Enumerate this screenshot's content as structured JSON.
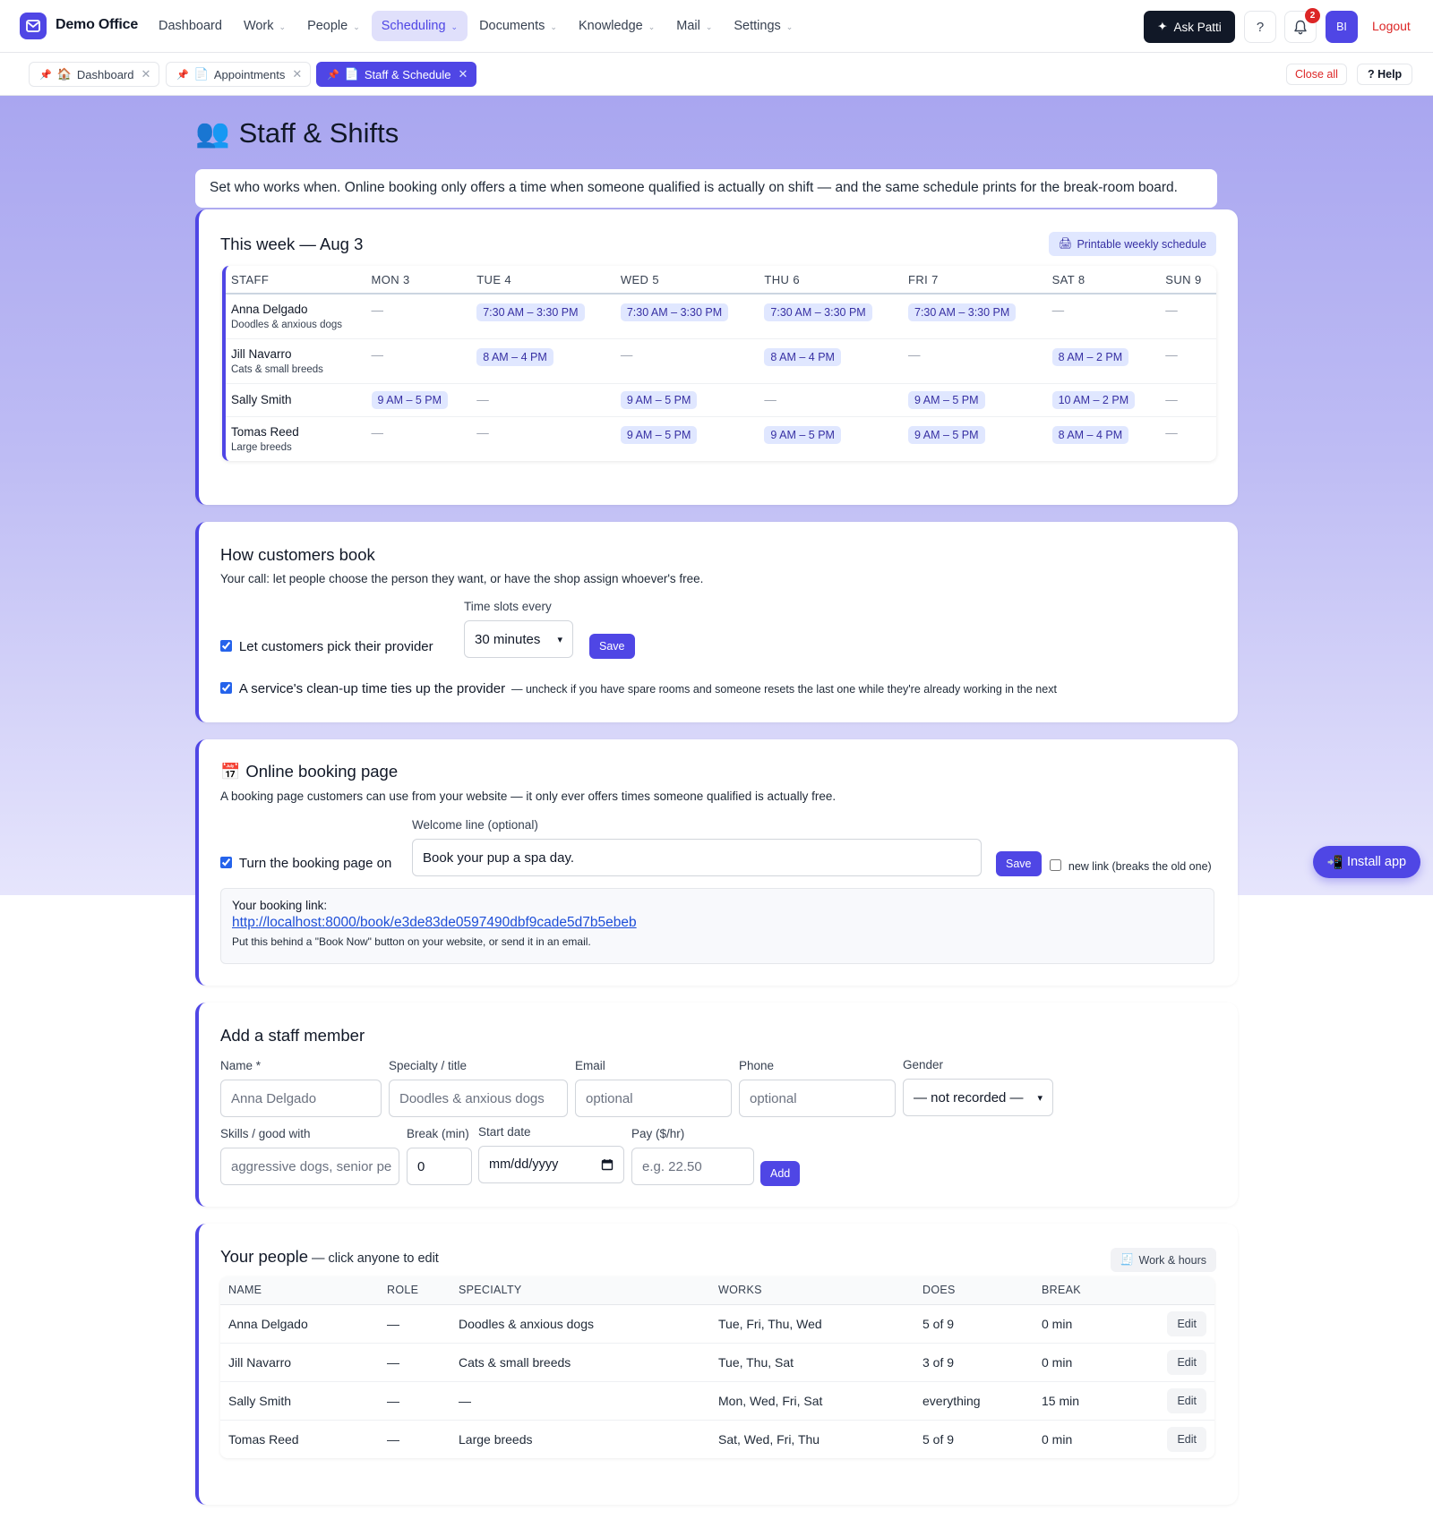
{
  "app": {
    "name": "Demo Office",
    "nav": [
      {
        "label": "Dashboard",
        "dropdown": false,
        "active": false
      },
      {
        "label": "Work",
        "dropdown": true,
        "active": false
      },
      {
        "label": "People",
        "dropdown": true,
        "active": false
      },
      {
        "label": "Scheduling",
        "dropdown": true,
        "active": true
      },
      {
        "label": "Documents",
        "dropdown": true,
        "active": false
      },
      {
        "label": "Knowledge",
        "dropdown": true,
        "active": false
      },
      {
        "label": "Mail",
        "dropdown": true,
        "active": false
      },
      {
        "label": "Settings",
        "dropdown": true,
        "active": false
      }
    ],
    "ask_label": "Ask Patti",
    "help_icon_label": "?",
    "notification_count": "2",
    "avatar_initials": "BI",
    "logout_label": "Logout",
    "accent_color": "#4f46e5"
  },
  "tabs": [
    {
      "pin": "📌",
      "icon": "🏠",
      "label": "Dashboard",
      "active": false
    },
    {
      "pin": "📌",
      "icon": "📄",
      "label": "Appointments",
      "active": false
    },
    {
      "pin": "📌",
      "icon": "📄",
      "label": "Staff & Schedule",
      "active": true
    }
  ],
  "tab_actions": {
    "close_all": "Close all",
    "help": "? Help"
  },
  "page": {
    "icon": "👥",
    "title": "Staff & Shifts",
    "intro": "Set who works when. Online booking only offers a time when someone qualified is actually on shift — and the same schedule prints for the break-room board."
  },
  "schedule": {
    "title": "This week — Aug 3",
    "print_icon": "🖨",
    "print_label": "Printable weekly schedule",
    "headers": [
      "STAFF",
      "MON 3",
      "TUE 4",
      "WED 5",
      "THU 6",
      "FRI 7",
      "SAT 8",
      "SUN 9"
    ],
    "rows": [
      {
        "name": "Anna Delgado",
        "specialty": "Doodles & anxious dogs",
        "shifts": [
          "—",
          "7:30 AM – 3:30 PM",
          "7:30 AM – 3:30 PM",
          "7:30 AM – 3:30 PM",
          "7:30 AM – 3:30 PM",
          "—",
          "—"
        ]
      },
      {
        "name": "Jill Navarro",
        "specialty": "Cats & small breeds",
        "shifts": [
          "—",
          "8 AM – 4 PM",
          "—",
          "8 AM – 4 PM",
          "—",
          "8 AM – 2 PM",
          "—"
        ]
      },
      {
        "name": "Sally Smith",
        "specialty": "",
        "shifts": [
          "9 AM – 5 PM",
          "—",
          "9 AM – 5 PM",
          "—",
          "9 AM – 5 PM",
          "10 AM – 2 PM",
          "—"
        ]
      },
      {
        "name": "Tomas Reed",
        "specialty": "Large breeds",
        "shifts": [
          "—",
          "—",
          "9 AM – 5 PM",
          "9 AM – 5 PM",
          "9 AM – 5 PM",
          "8 AM – 4 PM",
          "—"
        ]
      }
    ]
  },
  "booking_settings": {
    "title": "How customers book",
    "subtitle": "Your call: let people choose the person they want, or have the shop assign whoever's free.",
    "pick_provider_label": "Let customers pick their provider",
    "pick_provider_checked": true,
    "slots_label": "Time slots every",
    "slots_value": "30 minutes",
    "save_label": "Save",
    "cleanup_label": "A service's clean-up time ties up the provider",
    "cleanup_checked": true,
    "cleanup_note": "— uncheck if you have spare rooms and someone resets the last one while they're already working in the next"
  },
  "booking_page": {
    "icon": "📅",
    "title": "Online booking page",
    "subtitle": "A booking page customers can use from your website — it only ever offers times someone qualified is actually free.",
    "enable_label": "Turn the booking page on",
    "enable_checked": true,
    "welcome_label": "Welcome line (optional)",
    "welcome_value": "Book your pup a spa day.",
    "save_label": "Save",
    "new_link_label": "new link (breaks the old one)",
    "new_link_checked": false,
    "link_heading": "Your booking link:",
    "link_url": "http://localhost:8000/book/e3de83de0597490dbf9cade5d7b5ebeb",
    "link_note": "Put this behind a \"Book Now\" button on your website, or send it in an email."
  },
  "add_staff": {
    "title": "Add a staff member",
    "fields": {
      "name": {
        "label": "Name *",
        "placeholder": "Anna Delgado"
      },
      "specialty": {
        "label": "Specialty / title",
        "placeholder": "Doodles & anxious dogs"
      },
      "email": {
        "label": "Email",
        "placeholder": "optional"
      },
      "phone": {
        "label": "Phone",
        "placeholder": "optional"
      },
      "gender": {
        "label": "Gender",
        "value": "— not recorded —"
      },
      "skills": {
        "label": "Skills / good with",
        "placeholder": "aggressive dogs, senior pe"
      },
      "break": {
        "label": "Break (min)",
        "value": "0"
      },
      "start_date": {
        "label": "Start date",
        "placeholder": "mm/dd/yyyy"
      },
      "pay": {
        "label": "Pay ($/hr)",
        "placeholder": "e.g. 22.50"
      }
    },
    "add_label": "Add"
  },
  "people": {
    "title": "Your people",
    "subtitle": "— click anyone to edit",
    "work_icon": "🧾",
    "work_hours_label": "Work & hours",
    "headers": [
      "NAME",
      "ROLE",
      "SPECIALTY",
      "WORKS",
      "DOES",
      "BREAK"
    ],
    "rows": [
      {
        "name": "Anna Delgado",
        "role": "—",
        "specialty": "Doodles & anxious dogs",
        "works": "Tue, Fri, Thu, Wed",
        "does": "5 of 9",
        "break": "0 min"
      },
      {
        "name": "Jill Navarro",
        "role": "—",
        "specialty": "Cats & small breeds",
        "works": "Tue, Thu, Sat",
        "does": "3 of 9",
        "break": "0 min"
      },
      {
        "name": "Sally Smith",
        "role": "—",
        "specialty": "—",
        "works": "Mon, Wed, Fri, Sat",
        "does": "everything",
        "break": "15 min"
      },
      {
        "name": "Tomas Reed",
        "role": "—",
        "specialty": "Large breeds",
        "works": "Sat, Wed, Fri, Thu",
        "does": "5 of 9",
        "break": "0 min"
      }
    ],
    "edit_label": "Edit"
  },
  "install": {
    "icon": "📲",
    "label": "Install app"
  }
}
